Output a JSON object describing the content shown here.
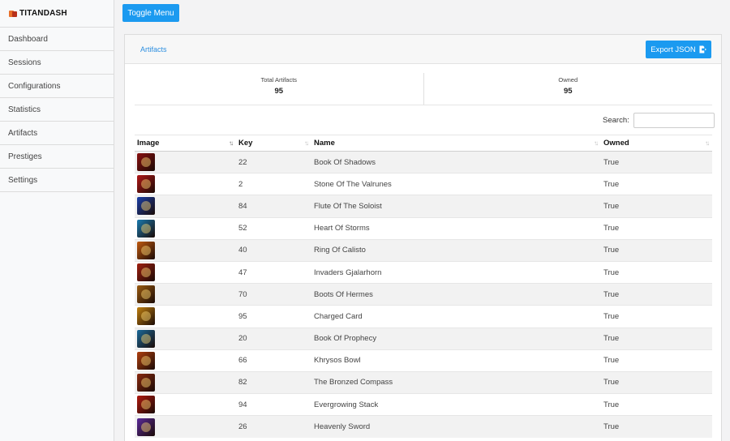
{
  "brand": {
    "name": "TITANDASH"
  },
  "sidebar": {
    "items": [
      {
        "label": "Dashboard"
      },
      {
        "label": "Sessions"
      },
      {
        "label": "Configurations"
      },
      {
        "label": "Statistics"
      },
      {
        "label": "Artifacts"
      },
      {
        "label": "Prestiges"
      },
      {
        "label": "Settings"
      }
    ]
  },
  "topbar": {
    "toggle_label": "Toggle Menu"
  },
  "card": {
    "breadcrumb": "Artifacts",
    "export_label": "Export JSON",
    "stats": [
      {
        "label": "Total Artifacts",
        "value": "95"
      },
      {
        "label": "Owned",
        "value": "95"
      }
    ],
    "search": {
      "label": "Search:",
      "value": "",
      "placeholder": ""
    }
  },
  "table": {
    "columns": [
      "Image",
      "Key",
      "Name",
      "Owned"
    ],
    "rows": [
      {
        "key": "22",
        "name": "Book Of Shadows",
        "owned": "True",
        "icon": "book-of-shadows-icon",
        "color": "#8a1010"
      },
      {
        "key": "2",
        "name": "Stone Of The Valrunes",
        "owned": "True",
        "icon": "stone-of-the-valrunes-icon",
        "color": "#b01818"
      },
      {
        "key": "84",
        "name": "Flute Of The Soloist",
        "owned": "True",
        "icon": "flute-of-the-soloist-icon",
        "color": "#1a3fa8"
      },
      {
        "key": "52",
        "name": "Heart Of Storms",
        "owned": "True",
        "icon": "heart-of-storms-icon",
        "color": "#1a7bb0"
      },
      {
        "key": "40",
        "name": "Ring Of Calisto",
        "owned": "True",
        "icon": "ring-of-calisto-icon",
        "color": "#c05a10"
      },
      {
        "key": "47",
        "name": "Invaders Gjalarhorn",
        "owned": "True",
        "icon": "invaders-gjalarhorn-icon",
        "color": "#a02010"
      },
      {
        "key": "70",
        "name": "Boots Of Hermes",
        "owned": "True",
        "icon": "boots-of-hermes-icon",
        "color": "#9a5a10"
      },
      {
        "key": "95",
        "name": "Charged Card",
        "owned": "True",
        "icon": "charged-card-icon",
        "color": "#c08010"
      },
      {
        "key": "20",
        "name": "Book Of Prophecy",
        "owned": "True",
        "icon": "book-of-prophecy-icon",
        "color": "#1a6a9a"
      },
      {
        "key": "66",
        "name": "Khrysos Bowl",
        "owned": "True",
        "icon": "khrysos-bowl-icon",
        "color": "#b04010"
      },
      {
        "key": "82",
        "name": "The Bronzed Compass",
        "owned": "True",
        "icon": "the-bronzed-compass-icon",
        "color": "#8a2a10"
      },
      {
        "key": "94",
        "name": "Evergrowing Stack",
        "owned": "True",
        "icon": "evergrowing-stack-icon",
        "color": "#b01a10"
      },
      {
        "key": "26",
        "name": "Heavenly Sword",
        "owned": "True",
        "icon": "heavenly-sword-icon",
        "color": "#5a2a9a"
      }
    ]
  },
  "colors": {
    "accent": "#1b9af0",
    "link": "#2d8fe0"
  }
}
